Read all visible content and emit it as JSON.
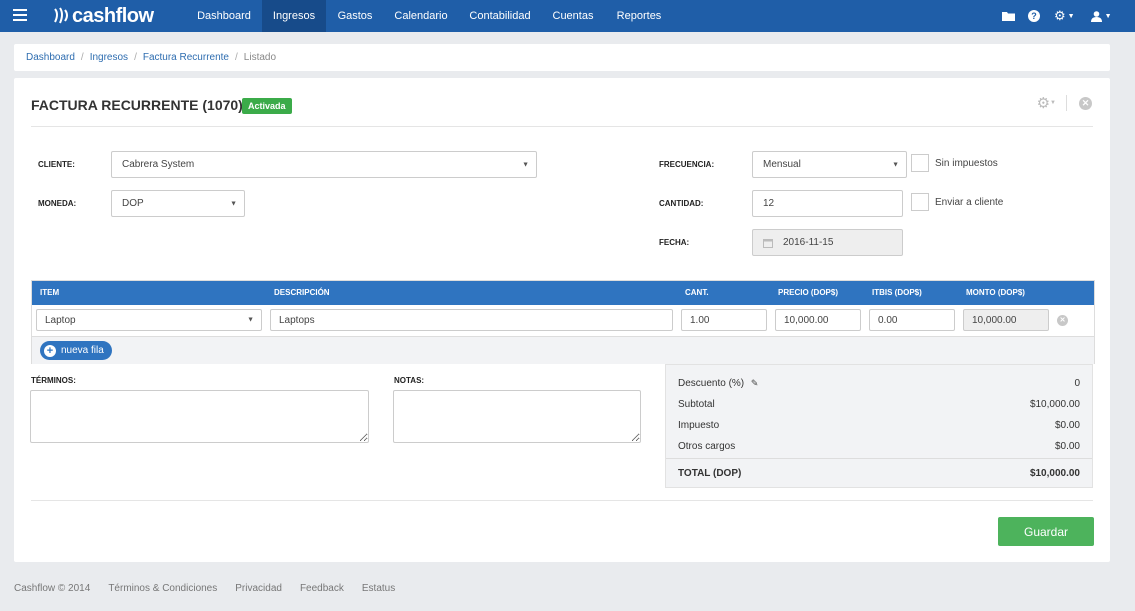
{
  "brand": {
    "name": "cashflow"
  },
  "nav": {
    "items": [
      {
        "label": "Dashboard",
        "active": false
      },
      {
        "label": "Ingresos",
        "active": true
      },
      {
        "label": "Gastos",
        "active": false
      },
      {
        "label": "Calendario",
        "active": false
      },
      {
        "label": "Contabilidad",
        "active": false
      },
      {
        "label": "Cuentas",
        "active": false
      },
      {
        "label": "Reportes",
        "active": false
      }
    ]
  },
  "breadcrumb": {
    "items": [
      "Dashboard",
      "Ingresos",
      "Factura Recurrente"
    ],
    "current": "Listado"
  },
  "page": {
    "title": "FACTURA RECURRENTE (1070)",
    "status_badge": "Activada"
  },
  "form": {
    "cliente": {
      "label": "CLIENTE:",
      "value": "Cabrera System"
    },
    "moneda": {
      "label": "MONEDA:",
      "value": "DOP"
    },
    "frecuencia": {
      "label": "FRECUENCIA:",
      "value": "Mensual"
    },
    "cantidad": {
      "label": "CANTIDAD:",
      "value": "12"
    },
    "fecha": {
      "label": "FECHA:",
      "value": "2016-11-15"
    },
    "sin_impuestos": {
      "label": "Sin impuestos",
      "checked": false
    },
    "enviar_cliente": {
      "label": "Enviar a cliente",
      "checked": false
    }
  },
  "table": {
    "headers": [
      "ITEM",
      "DESCRIPCIÓN",
      "CANT.",
      "PRECIO (DOP$)",
      "ITBIS (DOP$)",
      "MONTO (DOP$)"
    ],
    "rows": [
      {
        "item": "Laptop",
        "descripcion": "Laptops",
        "cant": "1.00",
        "precio": "10,000.00",
        "itbis": "0.00",
        "monto": "10,000.00"
      }
    ],
    "add_row_label": "nueva fila"
  },
  "terminos": {
    "label": "TÉRMINOS:"
  },
  "notas": {
    "label": "NOTAS:"
  },
  "totals": {
    "descuento": {
      "label": "Descuento (%)",
      "value": "0"
    },
    "subtotal": {
      "label": "Subtotal",
      "value": "$10,000.00"
    },
    "impuesto": {
      "label": "Impuesto",
      "value": "$0.00"
    },
    "otros": {
      "label": "Otros cargos",
      "value": "$0.00"
    },
    "total": {
      "label": "TOTAL (DOP)",
      "value": "$10,000.00"
    }
  },
  "actions": {
    "save_label": "Guardar"
  },
  "footer": {
    "copyright": "Cashflow © 2014",
    "links": [
      "Términos & Condiciones",
      "Privacidad",
      "Feedback",
      "Estatus"
    ]
  },
  "colors": {
    "nav": "#1f5ea8",
    "table_header": "#2f74c0",
    "badge": "#3bab49",
    "save": "#4db35c"
  },
  "icons": [
    "menu-icon",
    "folder-icon",
    "help-icon",
    "gear-icon",
    "user-icon",
    "calendar-icon",
    "pencil-icon",
    "close-circle-icon",
    "plus-circle-icon"
  ]
}
